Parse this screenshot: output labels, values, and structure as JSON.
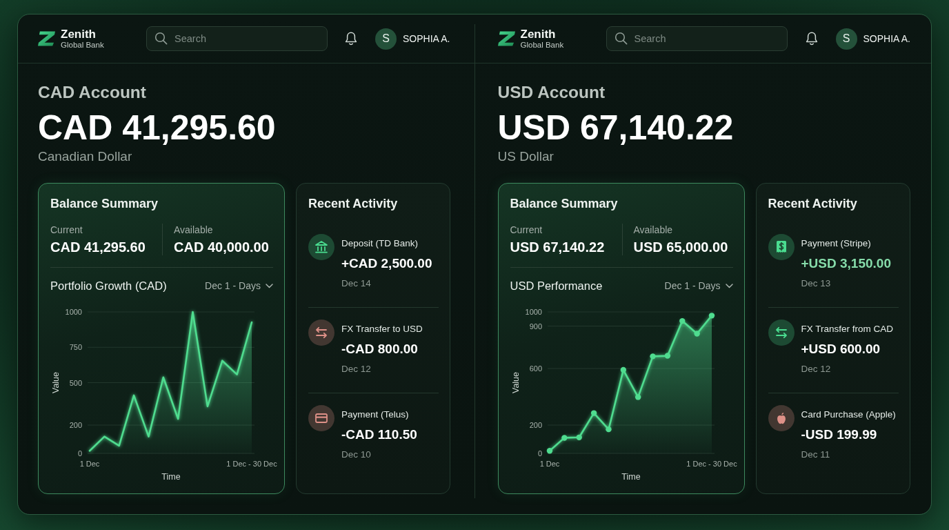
{
  "panels": [
    {
      "header": {
        "brand": {
          "name": "Zenith",
          "tagline": "Global Bank"
        },
        "search": {
          "placeholder": "Search"
        },
        "user": {
          "initial": "S",
          "name": "SOPHIA A."
        }
      },
      "account": {
        "title": "CAD Account",
        "balance": "CAD 41,295.60",
        "currency": "Canadian Dollar"
      },
      "summary": {
        "title": "Balance Summary",
        "figures": [
          {
            "label": "Current",
            "value": "CAD 41,295.60"
          },
          {
            "label": "Available",
            "value": "CAD 40,000.00"
          }
        ],
        "range": "Dec 1 - Days",
        "chart_data": {
          "type": "area",
          "title": "Portfolio Growth (CAD)",
          "xlabel": "Time",
          "ylabel": "Value",
          "categories": [
            "1 Dec",
            null,
            null,
            null,
            null,
            null,
            null,
            null,
            null,
            null,
            null,
            "1 Dec - 30 Dec"
          ],
          "series": [
            {
              "color": "#4fdc8f",
              "values": [
                18,
                119,
                54,
                410,
                119,
                538,
                244,
                1000,
                332,
                655,
                558,
                927
              ]
            }
          ],
          "ylim": [
            0,
            1000
          ],
          "yticks": [
            0,
            200,
            500,
            750,
            1000
          ],
          "grid": true
        }
      },
      "activity": {
        "title": "Recent Activity",
        "items": [
          {
            "kind": "bank",
            "color": "#1d4a33",
            "title": "Deposit (TD Bank)",
            "amount": "+CAD 2,500.00",
            "highlighted": false,
            "date": "Dec 14"
          },
          {
            "kind": "transfer",
            "color": "#423731",
            "title": "FX Transfer to USD",
            "amount": "-CAD 800.00",
            "highlighted": false,
            "date": "Dec 12"
          },
          {
            "kind": "card",
            "color": "#423731",
            "title": "Payment (Telus)",
            "amount": "-CAD 110.50",
            "highlighted": false,
            "date": "Dec 10"
          }
        ]
      }
    },
    {
      "header": {
        "brand": {
          "name": "Zenith",
          "tagline": "Global Bank"
        },
        "search": {
          "placeholder": "Search"
        },
        "user": {
          "initial": "S",
          "name": "SOPHIA A."
        }
      },
      "account": {
        "title": "USD Account",
        "balance": "USD 67,140.22",
        "currency": "US Dollar"
      },
      "summary": {
        "title": "Balance Summary",
        "figures": [
          {
            "label": "Current",
            "value": "USD 67,140.22"
          },
          {
            "label": "Available",
            "value": "USD 65,000.00"
          }
        ],
        "range": "Dec 1 - Days",
        "chart_data": {
          "type": "area",
          "title": "USD Performance",
          "xlabel": "Time",
          "ylabel": "Value",
          "categories": [
            "1 Dec",
            null,
            null,
            null,
            null,
            null,
            null,
            null,
            null,
            null,
            null,
            "1 Dec - 30 Dec"
          ],
          "series": [
            {
              "color": "#4fdc8f",
              "marker": "circle",
              "values": [
                18,
                110,
                113,
                285,
                170,
                590,
                398,
                686,
                690,
                936,
                846,
                974
              ]
            }
          ],
          "ylim": [
            0,
            1000
          ],
          "yticks": [
            0,
            200,
            600,
            900,
            1000
          ],
          "grid": true
        }
      },
      "activity": {
        "title": "Recent Activity",
        "items": [
          {
            "kind": "receipt",
            "color": "#1d4a33",
            "title": "Payment (Stripe)",
            "amount": "+USD 3,150.00",
            "highlighted": true,
            "date": "Dec 13"
          },
          {
            "kind": "transfer",
            "color": "#1d4a33",
            "title": "FX Transfer from CAD",
            "amount": "+USD 600.00",
            "highlighted": false,
            "date": "Dec 12"
          },
          {
            "kind": "apple",
            "color": "#423731",
            "title": "Card Purchase (Apple)",
            "amount": "-USD 199.99",
            "highlighted": false,
            "date": "Dec 11"
          }
        ]
      }
    }
  ]
}
